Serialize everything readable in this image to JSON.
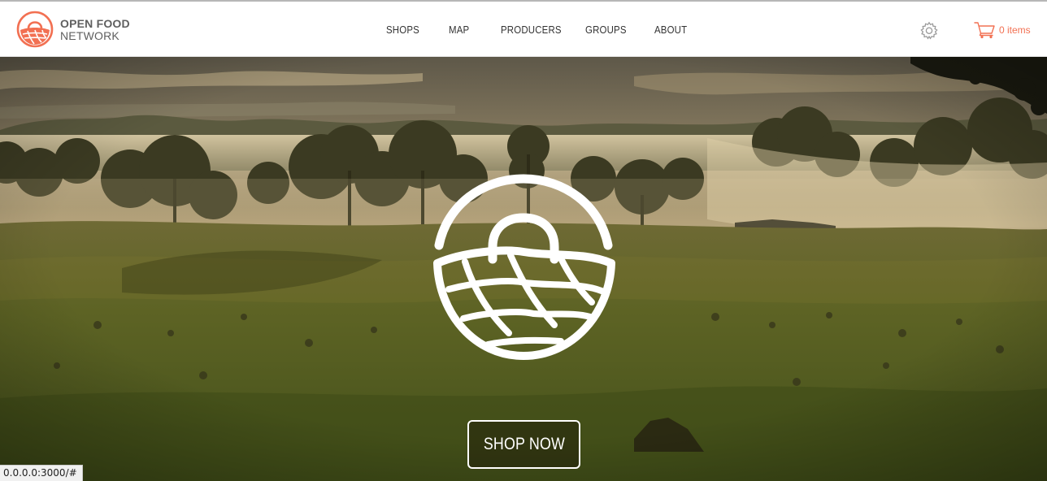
{
  "brand": {
    "line1": "OPEN FOOD",
    "line2": "NETWORK",
    "accent_color": "#f27052",
    "logo_icon": "basket-logo-icon"
  },
  "nav": {
    "items": [
      {
        "label": "SHOPS"
      },
      {
        "label": "MAP"
      },
      {
        "label": "PRODUCERS"
      },
      {
        "label": "GROUPS"
      },
      {
        "label": "ABOUT"
      }
    ]
  },
  "header_actions": {
    "settings_icon": "gear-icon",
    "cart_icon": "cart-icon",
    "cart_label": "0 items"
  },
  "hero": {
    "image": "misty-farmland-sunrise",
    "logo_icon": "basket-logo-icon",
    "cta_label": "SHOP NOW"
  },
  "status_bar": {
    "url": "0.0.0.0:3000/#"
  }
}
